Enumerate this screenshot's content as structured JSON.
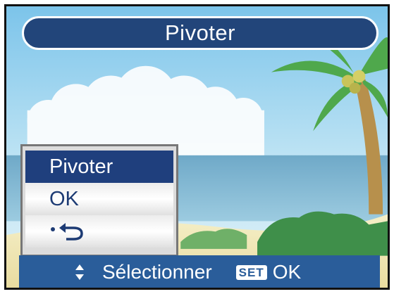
{
  "header": {
    "title": "Pivoter"
  },
  "menu": {
    "items": [
      {
        "label": "Pivoter",
        "selected": true
      },
      {
        "label": "OK",
        "selected": false
      },
      {
        "icon": "back-arrow-icon",
        "selected": false
      }
    ]
  },
  "footer": {
    "nav_icon": "up-down-arrows-icon",
    "select_label": "Sélectionner",
    "set_key": "SET",
    "ok_label": "OK"
  },
  "colors": {
    "title_bar": "#22457a",
    "menu_selected": "#1f3f7d",
    "footer_bar": "#2a5d9a"
  }
}
